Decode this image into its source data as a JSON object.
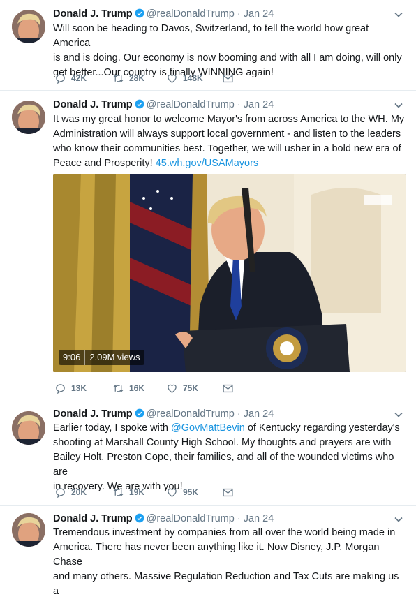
{
  "colors": {
    "link": "#1b95e0",
    "muted": "#657786",
    "verified": "#1da1f2",
    "text": "#14171a"
  },
  "tweets": [
    {
      "author": "Donald J. Trump",
      "handle": "@realDonaldTrump",
      "separator": "·",
      "date": "Jan 24",
      "lines": [
        "Will soon be heading to Davos, Switzerland, to tell the world how great America",
        "is and is doing. Our economy is now booming and with all I am doing, will only",
        "get better...Our country is finally WINNING again!"
      ],
      "replies": "42K",
      "retweets": "28K",
      "likes": "148K"
    },
    {
      "author": "Donald J. Trump",
      "handle": "@realDonaldTrump",
      "separator": "·",
      "date": "Jan 24",
      "lines": [
        "It was my great honor to welcome Mayor's from across America to the WH. My",
        "Administration will always support local government - and listen to the leaders",
        "who know their communities best. Together, we will usher in a bold new era of"
      ],
      "last_line": "Peace and Prosperity!",
      "link": "45.wh.gov/USAMayors",
      "video_duration": "9:06",
      "video_views": "2.09M views",
      "replies": "13K",
      "retweets": "16K",
      "likes": "75K"
    },
    {
      "author": "Donald J. Trump",
      "handle": "@realDonaldTrump",
      "separator": "·",
      "date": "Jan 24",
      "line1_pre": "Earlier today, I spoke with",
      "mention": "@GovMattBevin",
      "line1_post": "of Kentucky regarding yesterday's",
      "lines": [
        "shooting at Marshall County High School. My thoughts and prayers are with",
        "Bailey Holt, Preston Cope, their families, and all of the wounded victims who are",
        "in recovery. We are with you!"
      ],
      "replies": "20K",
      "retweets": "19K",
      "likes": "95K"
    },
    {
      "author": "Donald J. Trump",
      "handle": "@realDonaldTrump",
      "separator": "·",
      "date": "Jan 24",
      "lines": [
        "Tremendous investment by companies from all over the world being made in",
        "America. There has never been anything like it. Now Disney, J.P. Morgan Chase",
        "and many others. Massive Regulation Reduction and Tax Cuts are making us a"
      ]
    }
  ]
}
